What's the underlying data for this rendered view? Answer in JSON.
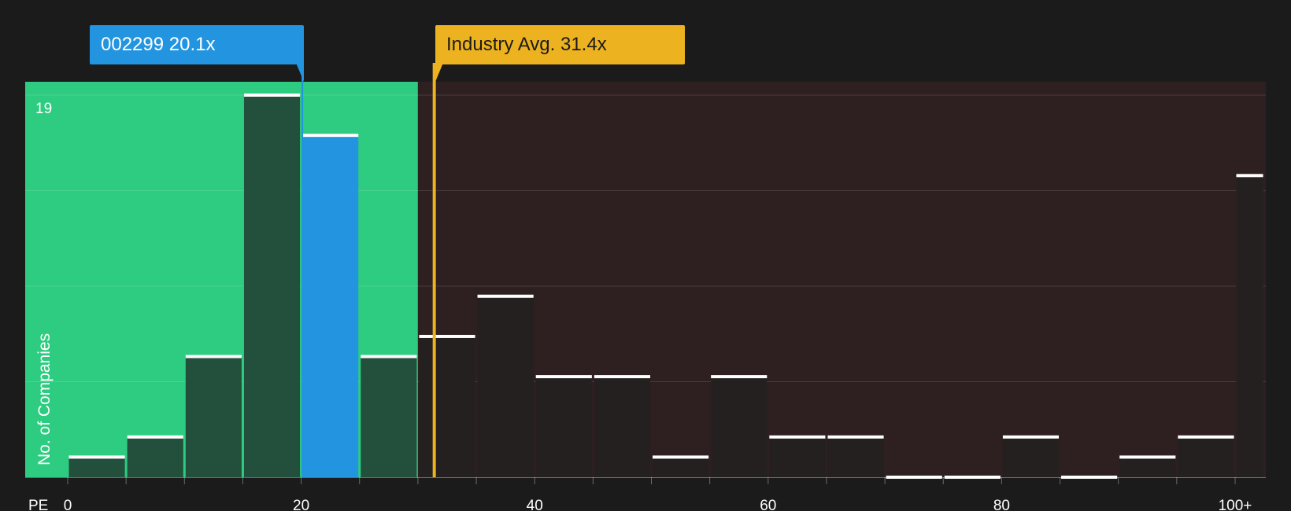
{
  "company_callout": {
    "ticker": "002299",
    "value": "20.1x"
  },
  "industry_callout": {
    "label": "Industry Avg.",
    "value": "31.4x"
  },
  "colors": {
    "background": "#1b1b1b",
    "undervalued_zone": "#2ecc80",
    "overvalued_zone": "#2e1f20",
    "company_bar": "#2394e0",
    "industry_line": "#edb21f",
    "bar_in_zone": "#23503c",
    "bar_outside_zone": "#252020"
  },
  "chart_data": {
    "type": "bar",
    "metric": "PE",
    "xlabel": "PE",
    "ylabel": "No. of Companies",
    "x_ticks": [
      "0",
      "20",
      "40",
      "60",
      "80",
      "100+"
    ],
    "x_tick_values": [
      0,
      20,
      40,
      60,
      80,
      100
    ],
    "y_max_label": "19",
    "ylim": [
      0,
      19
    ],
    "bin_width": 5,
    "bins": [
      {
        "from": 0,
        "to": 5,
        "count": 1
      },
      {
        "from": 5,
        "to": 10,
        "count": 2
      },
      {
        "from": 10,
        "to": 15,
        "count": 6
      },
      {
        "from": 15,
        "to": 20,
        "count": 19
      },
      {
        "from": 20,
        "to": 25,
        "count": 17,
        "highlight": true
      },
      {
        "from": 25,
        "to": 30,
        "count": 6
      },
      {
        "from": 30,
        "to": 35,
        "count": 7
      },
      {
        "from": 35,
        "to": 40,
        "count": 9
      },
      {
        "from": 40,
        "to": 45,
        "count": 5
      },
      {
        "from": 45,
        "to": 50,
        "count": 5
      },
      {
        "from": 50,
        "to": 55,
        "count": 1
      },
      {
        "from": 55,
        "to": 60,
        "count": 5
      },
      {
        "from": 60,
        "to": 65,
        "count": 2
      },
      {
        "from": 65,
        "to": 70,
        "count": 2
      },
      {
        "from": 70,
        "to": 75,
        "count": 0
      },
      {
        "from": 75,
        "to": 80,
        "count": 0
      },
      {
        "from": 80,
        "to": 85,
        "count": 2
      },
      {
        "from": 85,
        "to": 90,
        "count": 0
      },
      {
        "from": 90,
        "to": 95,
        "count": 1
      },
      {
        "from": 95,
        "to": 100,
        "count": 2
      },
      {
        "from": 100,
        "to": 102.5,
        "count": 15
      }
    ],
    "company_value": 20.1,
    "industry_average": 31.4,
    "undervalued_zone": [
      0,
      30
    ],
    "gridlines": true
  }
}
